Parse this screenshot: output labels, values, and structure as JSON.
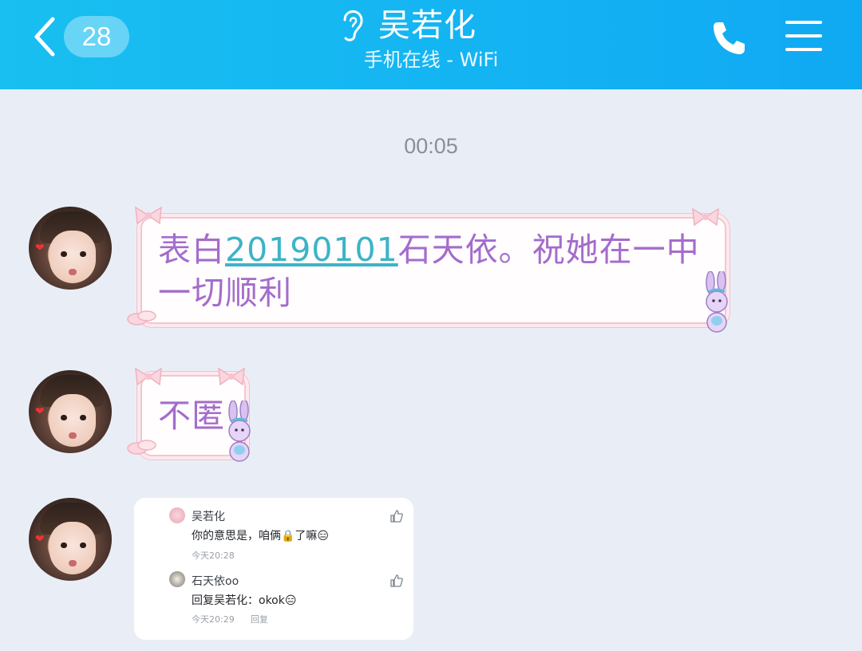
{
  "header": {
    "unread_count": "28",
    "contact_name": "吴若化",
    "status": "手机在线 - WiFi",
    "icons": {
      "back": "chevron-left-icon",
      "ear": "ear-icon",
      "call": "phone-icon",
      "menu": "hamburger-menu-icon"
    }
  },
  "chat": {
    "timestamp": "00:05",
    "messages": [
      {
        "type": "text",
        "parts": {
          "before": "表白",
          "link": "20190101",
          "after": "石天依。祝她在一中",
          "line2": "一切顺利"
        }
      },
      {
        "type": "text",
        "text": "不匿"
      },
      {
        "type": "comment-card",
        "comments": [
          {
            "user": "吴若化",
            "text": "你的意思是，咱俩🔒了嘛😑",
            "time": "今天20:28"
          },
          {
            "user": "石天依oo",
            "text": "回复吴若化：okok😑",
            "time": "今天20:29",
            "reply_label": "回复"
          }
        ]
      }
    ]
  },
  "colors": {
    "header_gradient_start": "#19bff0",
    "header_gradient_end": "#10a9f3",
    "background": "#e9eef6",
    "bubble_text": "#a46ccc",
    "link": "#3bb4c7"
  }
}
